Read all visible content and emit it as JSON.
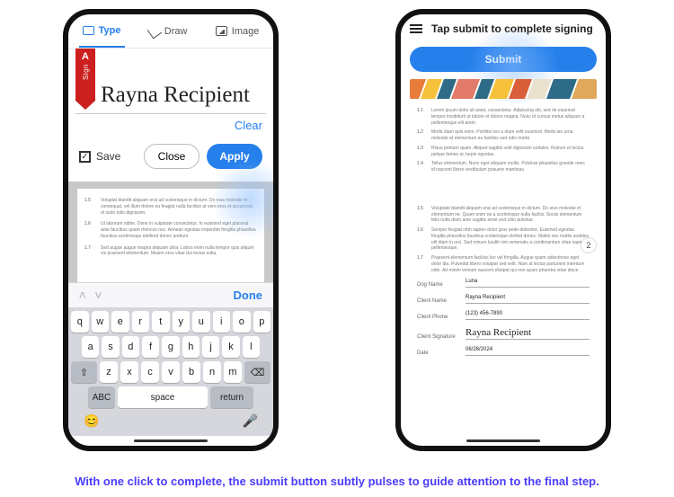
{
  "left": {
    "tabs": {
      "type": "Type",
      "draw": "Draw",
      "image": "Image"
    },
    "ribbon": {
      "logo": "A",
      "label": "Sign"
    },
    "signature_text": "Rayna Recipient",
    "clear_label": "Clear",
    "save_label": "Save",
    "close_label": "Close",
    "apply_label": "Apply",
    "doc_paras": [
      {
        "n": "1.5",
        "t": "Voluptat blandit aliquam erat ad scelerisque in dictum. Do eius molestie et consequat, vel illum dolore eu feugiat nulla facilisis at vero eros et accumsan et iusto odio dignissim."
      },
      {
        "n": "1.6",
        "t": "Ut laborum nibhe. Done in vulputate consectetur. In euismod eget placerat ante faucibus quam rhoncus nec. Aenean egestas imperdiet fringilla phasellus faucibus scelerisque eleifend donec pretium."
      },
      {
        "n": "1.7",
        "t": "Sed augue augue magna aliquam ultra. Lobos enim nulla tempor quis aliquet vis praesent elementum. Maxim eros vitae dui lectus nulla."
      }
    ],
    "done_label": "Done",
    "keyboard": {
      "row1": [
        "q",
        "w",
        "e",
        "r",
        "t",
        "y",
        "u",
        "i",
        "o",
        "p"
      ],
      "row2": [
        "a",
        "s",
        "d",
        "f",
        "g",
        "h",
        "j",
        "k",
        "l"
      ],
      "shift": "⇧",
      "row3": [
        "z",
        "x",
        "c",
        "v",
        "b",
        "n",
        "m"
      ],
      "bksp": "⌫",
      "abc": "ABC",
      "space": "space",
      "ret": "return",
      "emoji": "😊",
      "mic": "🎤"
    }
  },
  "right": {
    "title": "Tap submit to complete signing",
    "submit_label": "Submit",
    "block1": [
      {
        "n": "1.1",
        "t": "Lorem ipsum dolor sit amet, consectetur. Adipiscing elit, sed do eiusmod tempor incididunt ut labore et dolore magna. Nunc id cursus metus aliquam a pellentesque elit amet."
      },
      {
        "n": "1.2",
        "t": "Morbi diam quis enim. Porttitor leo a diam velit euismod. Morbi leo urna molestie at elementum eu facilisis sed odio morbi."
      },
      {
        "n": "1.3",
        "t": "Risus pretium quam. Aliquet sagittis velit dignissim sodales. Rutrum et lectus pelque fames ac turpis egestas."
      },
      {
        "n": "1.4",
        "t": "Tellus elementum. Nunc eget aliquam mollis. Pulvinar phasellus gravide onec id nascent libero vestibulum posuere mantinas."
      }
    ],
    "block2": [
      {
        "n": "1.5",
        "t": "Voluptate blandit aliquam erat ad scelerisque in dictum. Do eius molestie et elementum ne. Quam enim ne a scelerisque nulla facilisi. Sociis elementum felis nulla diam ante sagittis amet sed odio pulvinar."
      },
      {
        "n": "1.6",
        "t": "Semper feugiat nibh sapien dolor grav pede doleorbe. Euismod egestas fringilla phacellus faucibus scelerisque eleifed donec. Mattis nec mattis sodales elit diam in orci. Sed minum lucditi nim venenatis a condimantum vitae sapien pellentesque."
      },
      {
        "n": "1.7",
        "t": "Praesent elementum facilisis leo vel fringilla. Augue quam adiectense eget dolor dia. Pulvedat libero volutpat sed velit. Nam at lectus parturient interdum odio. Ad minim veniam nascent ellutpat qui non quam pharetra vitae disce."
      }
    ],
    "page_badge": "2",
    "form": {
      "dog_name_label": "Dog Name",
      "dog_name": "Luna",
      "client_name_label": "Client Name",
      "client_name": "Rayna Recipient",
      "client_phone_label": "Client Phone",
      "client_phone": "(123) 456-7890",
      "client_sig_label": "Client Signature",
      "client_sig": "Rayna Recipient",
      "date_label": "Date",
      "date": "06/28/2024"
    }
  },
  "caption": "With one click to complete, the submit button subtly pulses to guide attention to the final step."
}
